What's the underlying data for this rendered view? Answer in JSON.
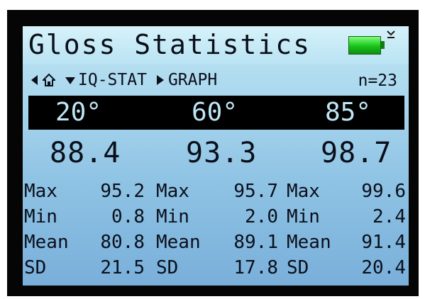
{
  "header": {
    "title": "Gloss Statistics",
    "battery_icon": "battery-full-icon",
    "battery_color": "#19c419",
    "connection_icon": "usb-icon"
  },
  "status": {
    "left_icon": "arrow-left-icon",
    "home_icon": "home-icon",
    "dropdown_icon": "triangle-down-icon",
    "mode_label": "IQ-STAT",
    "right_icon": "arrow-right-icon",
    "next_label": "GRAPH",
    "count": "n=23"
  },
  "angles": [
    "20°",
    "60°",
    "85°"
  ],
  "readings": [
    "88.4",
    "93.3",
    "98.7"
  ],
  "stats": {
    "labels": [
      "Max",
      "Min",
      "Mean",
      "SD"
    ],
    "columns": [
      {
        "angle": "20°",
        "values": [
          "95.2",
          "0.8",
          "80.8",
          "21.5"
        ]
      },
      {
        "angle": "60°",
        "values": [
          "95.7",
          "2.0",
          "89.1",
          "17.8"
        ]
      },
      {
        "angle": "85°",
        "values": [
          "99.6",
          "2.4",
          "91.4",
          "20.4"
        ]
      }
    ]
  },
  "colors": {
    "screen_top": "#c2e7f4",
    "screen_bottom": "#79afda",
    "angle_bar": "#000000",
    "angle_text": "#bfe6f5",
    "text": "#0a0f1a"
  }
}
